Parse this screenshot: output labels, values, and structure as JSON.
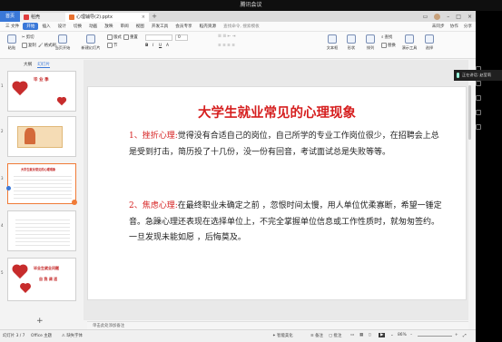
{
  "meeting": {
    "title": "腾讯会议",
    "speaker": "正在讲话: 赵莹莉"
  },
  "tabs": {
    "home": "首页",
    "doc_tab": "稻壳",
    "ppt_tab": "心理辅导(2).pptx",
    "close": "×",
    "add": "+"
  },
  "menu": {
    "items": [
      "三 文件",
      "开始",
      "插入",
      "设计",
      "切换",
      "动画",
      "放映",
      "审阅",
      "视图",
      "开发工具",
      "会员专享",
      "稻壳资源"
    ],
    "active_index": 1,
    "search": "查找命令, 搜索模板",
    "right": [
      "未同步",
      "协作",
      "分享"
    ]
  },
  "ribbon": {
    "paste": "粘贴",
    "cut": "剪切",
    "copy": "复制",
    "format_painter": "格式刷",
    "from_start": "当页开始",
    "new_slide": "新建幻灯片",
    "layout": "版式",
    "section": "节",
    "reset": "重置",
    "font_size": "0",
    "text_box": "文本框",
    "shapes": "形状",
    "arrange": "排列",
    "replace": "替换",
    "find": "查找",
    "present_tools": "演示工具",
    "select": "选择"
  },
  "panel": {
    "tabs": [
      "大纲",
      "幻灯片"
    ],
    "active_index": 1
  },
  "thumbnails": [
    {
      "num": "1",
      "title": "毕  业  季"
    },
    {
      "num": "2",
      "title": ""
    },
    {
      "num": "3",
      "title": "大学生就业常见的心理现象"
    },
    {
      "num": "4",
      "title": ""
    },
    {
      "num": "5",
      "title": "毕业生就业问题",
      "subtitle": "自 我 调 适"
    }
  ],
  "slide": {
    "title": "大学生就业常见的心理现象",
    "p1_label": "1、挫折心理:",
    "p1_text": "觉得没有合适自己的岗位，自己所学的专业工作岗位很少，在招聘会上总是受到打击，简历投了十几份，没一份有回音，考试面试总是失败等等。",
    "p2_label": "2、焦虑心理:",
    "p2_text": "在最终职业未确定之前 ，忽恨时间太慢，用人单位优柔寡断，希望一锤定音。急躁心理还表现在选择单位上，不完全掌握单位信息或工作性质时，就匆匆签约。一旦发现未能如愿 ，后悔莫及。"
  },
  "notes": "单击此处添加备注",
  "status": {
    "slide_counter": "幻灯片 3 / 7",
    "theme": "Office 主题",
    "missing_font": "缺失字体",
    "beautify": "智能美化",
    "notes_btn": "备注",
    "comment_btn": "批注",
    "zoom": "86%"
  }
}
